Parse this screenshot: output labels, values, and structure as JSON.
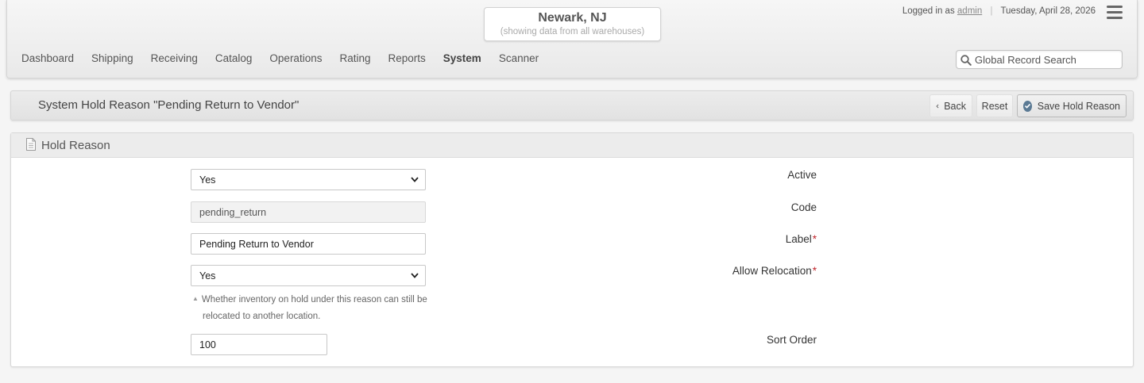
{
  "header": {
    "warehouse_name": "Newark, NJ",
    "warehouse_sub": "(showing data from all warehouses)",
    "logged_in_prefix": "Logged in as",
    "username": "admin",
    "date": "Tuesday, April 28, 2026",
    "nav": [
      "Dashboard",
      "Shipping",
      "Receiving",
      "Catalog",
      "Operations",
      "Rating",
      "Reports",
      "System",
      "Scanner"
    ],
    "active_nav": "System",
    "search_placeholder": "Global Record Search"
  },
  "titlebar": {
    "title": "System Hold Reason \"Pending Return to Vendor\"",
    "back_label": "Back",
    "reset_label": "Reset",
    "save_label": "Save Hold Reason"
  },
  "panel": {
    "title": "Hold Reason",
    "fields": {
      "active": {
        "label": "Active",
        "value": "Yes"
      },
      "code": {
        "label": "Code",
        "value": "pending_return"
      },
      "label": {
        "label": "Label",
        "required_mark": "*",
        "value": "Pending Return to Vendor"
      },
      "allow_relocation": {
        "label": "Allow Relocation",
        "required_mark": "*",
        "value": "Yes",
        "hint_line1": "Whether inventory on hold under this reason can still be",
        "hint_line2": "relocated to another location."
      },
      "sort_order": {
        "label": "Sort Order",
        "value": "100"
      }
    }
  },
  "icons": {
    "menu": "hamburger-icon",
    "search": "search-icon",
    "back": "chevron-left-icon",
    "save": "check-circle-icon",
    "panel": "document-icon",
    "select": "chevron-down-icon",
    "hint": "triangle-up-icon"
  },
  "colors": {
    "required": "#c0262d",
    "save_icon": "#5b7a94"
  }
}
